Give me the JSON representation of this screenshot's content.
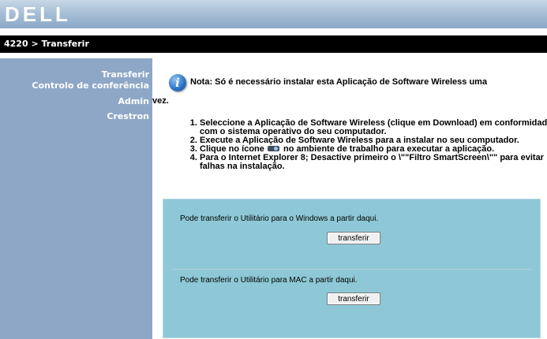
{
  "header": {
    "logo_text": "DELL"
  },
  "breadcrumb": {
    "text": "4220 > Transferir"
  },
  "sidebar": {
    "items": [
      {
        "label": "Transferir"
      },
      {
        "label": "Controlo de conferência"
      },
      {
        "label": "Admin"
      },
      {
        "label": "Crestron"
      }
    ]
  },
  "main": {
    "note_line1": "Nota: Só é necessário instalar esta Aplicação de Software Wireless uma",
    "note_line2": "vez.",
    "steps": [
      "Seleccione a Aplicação de Software Wireless (clique em Download) em conformidade com o sistema operativo do seu computador.",
      "Execute a Aplicação de Software Wireless para a instalar no seu computador.",
      "Clique no ícone",
      "no ambiente de trabalho para executar a aplicação.",
      "Para o Internet Explorer 8; Desactive primeiro o \\\"\"Filtro SmartScreen\\\"\" para evitar falhas na instalação."
    ],
    "download_windows_text": "Pode transferir o Utilitário para o Windows a partir daqui.",
    "download_windows_button": "transferir",
    "download_mac_text": "Pode transferir o Utilitário para MAC a partir daqui.",
    "download_mac_button": "transferir"
  },
  "icons": {
    "info": "info-icon",
    "projector": "projector-icon"
  }
}
